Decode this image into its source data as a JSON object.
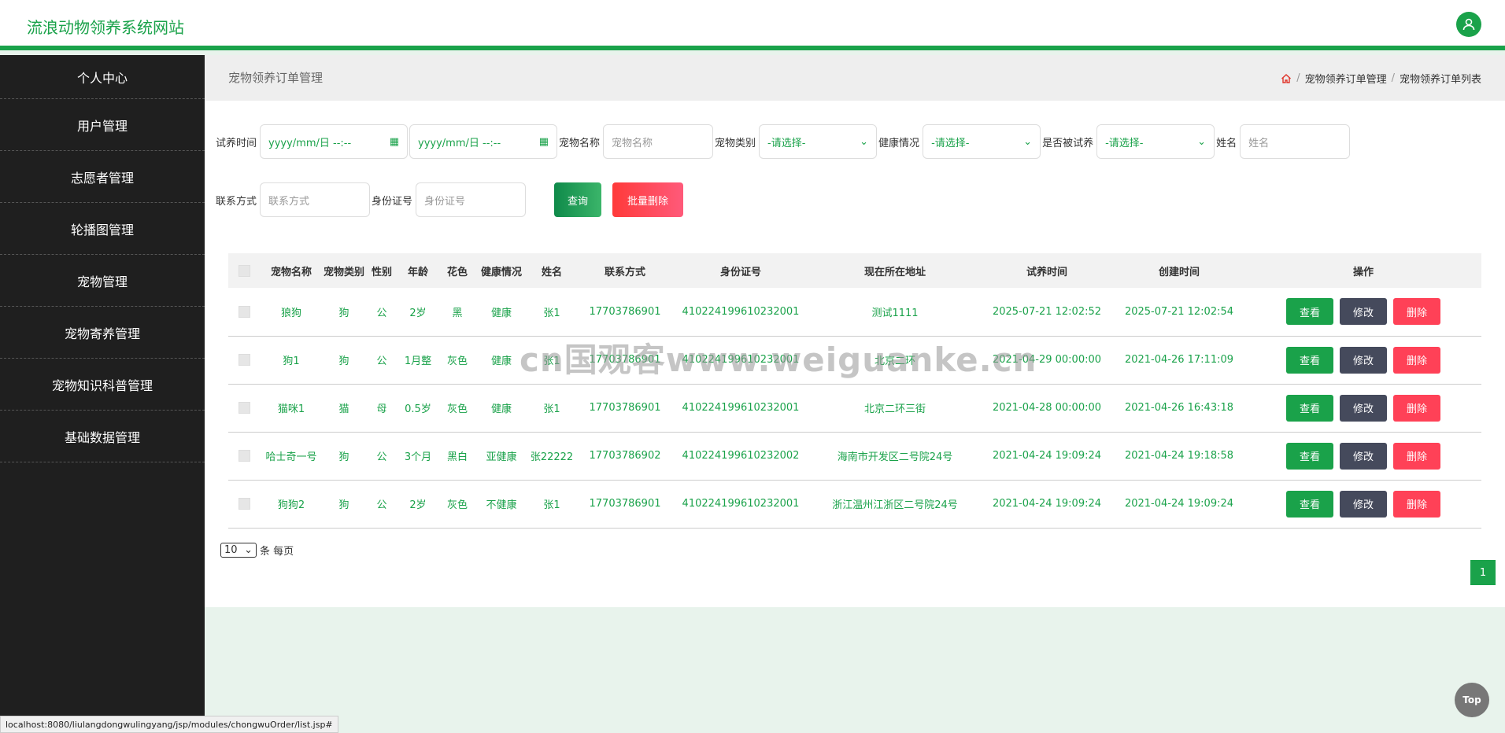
{
  "header": {
    "site_title": "流浪动物领养系统网站"
  },
  "sidebar": {
    "items": [
      {
        "label": "个人中心"
      },
      {
        "label": "用户管理"
      },
      {
        "label": "志愿者管理"
      },
      {
        "label": "轮播图管理"
      },
      {
        "label": "宠物管理"
      },
      {
        "label": "宠物寄养管理"
      },
      {
        "label": "宠物知识科普管理"
      },
      {
        "label": "基础数据管理"
      }
    ]
  },
  "page": {
    "title": "宠物领养订单管理",
    "crumb1": "宠物领养订单管理",
    "crumb2": "宠物领养订单列表",
    "sep": "/"
  },
  "filters": {
    "trial_time_label": "试养时间",
    "date_placeholder": "yyyy/mm/日 --:--",
    "pet_name_label": "宠物名称",
    "pet_name_placeholder": "宠物名称",
    "pet_type_label": "宠物类别",
    "health_label": "健康情况",
    "trial_label": "是否被试养",
    "select_default": "-请选择-",
    "name_label": "姓名",
    "name_placeholder": "姓名",
    "phone_label": "联系方式",
    "phone_placeholder": "联系方式",
    "id_label": "身份证号",
    "id_placeholder": "身份证号",
    "query_btn": "查询",
    "batch_delete_btn": "批量删除"
  },
  "table": {
    "headers": [
      "宠物名称",
      "宠物类别",
      "性别",
      "年龄",
      "花色",
      "健康情况",
      "姓名",
      "联系方式",
      "身份证号",
      "现在所在地址",
      "试养时间",
      "创建时间",
      "操作"
    ],
    "rows": [
      [
        "狼狗",
        "狗",
        "公",
        "2岁",
        "黑",
        "健康",
        "张1",
        "17703786901",
        "410224199610232001",
        "测试1111",
        "2025-07-21 12:02:52",
        "2025-07-21 12:02:54"
      ],
      [
        "狗1",
        "狗",
        "公",
        "1月整",
        "灰色",
        "健康",
        "张1",
        "17703786901",
        "410224199610232001",
        "北京二环",
        "2021-04-29 00:00:00",
        "2021-04-26 17:11:09"
      ],
      [
        "猫咪1",
        "猫",
        "母",
        "0.5岁",
        "灰色",
        "健康",
        "张1",
        "17703786901",
        "410224199610232001",
        "北京二环三街",
        "2021-04-28 00:00:00",
        "2021-04-26 16:43:18"
      ],
      [
        "哈士奇一号",
        "狗",
        "公",
        "3个月",
        "黑白",
        "亚健康",
        "张22222",
        "17703786902",
        "410224199610232002",
        "海南市开发区二号院24号",
        "2021-04-24 19:09:24",
        "2021-04-24 19:18:58"
      ],
      [
        "狗狗2",
        "狗",
        "公",
        "2岁",
        "灰色",
        "不健康",
        "张1",
        "17703786901",
        "410224199610232001",
        "浙江温州江浙区二号院24号",
        "2021-04-24 19:09:24",
        "2021-04-24 19:09:24"
      ]
    ],
    "actions": {
      "view": "查看",
      "edit": "修改",
      "delete": "删除"
    }
  },
  "pager": {
    "page_size": "10",
    "per_page_label": "条 每页",
    "current_page": "1"
  },
  "status_url": "localhost:8080/liulangdongwulingyang/jsp/modules/chongwuOrder/list.jsp#",
  "top_label": "Top",
  "watermark": "cn国观客www.weiguanke.cn",
  "colors": {
    "accent": "#1aa24a",
    "sidebar": "#1f1f1f",
    "danger": "#ff4157"
  }
}
